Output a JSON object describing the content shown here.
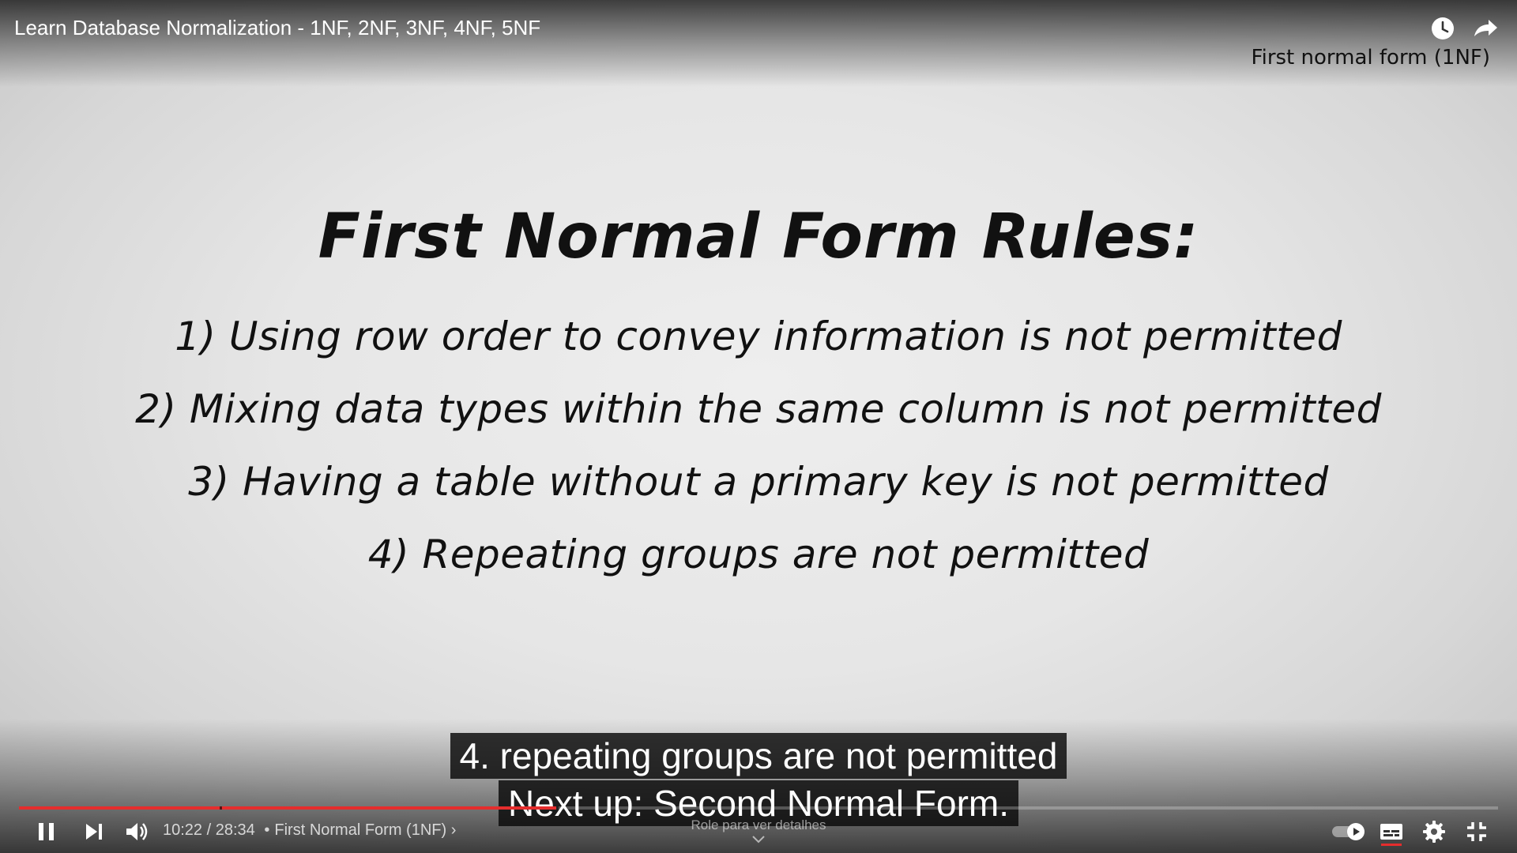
{
  "header": {
    "video_title": "Learn Database Normalization - 1NF, 2NF, 3NF, 4NF, 5NF",
    "chapter_label": "First normal form (1NF)",
    "icons": [
      "watch-later-icon",
      "share-icon"
    ]
  },
  "slide": {
    "heading": "First Normal Form Rules:",
    "rules": [
      "1) Using row order to convey information is not permitted",
      "2) Mixing data types within the same column is not permitted",
      "3) Having a table without a primary key is not permitted",
      "4) Repeating groups are not permitted"
    ]
  },
  "captions": {
    "line1": "4. repeating groups are not permitted",
    "line2": "Next up: Second Normal Form."
  },
  "controls": {
    "time_current": "10:22",
    "time_total": "28:34",
    "time_separator": "/",
    "chapter_separator": "•",
    "chapter": "First Normal Form (1NF)",
    "chapter_chevron": "›",
    "scroll_hint": "Role para ver detalhes",
    "progress_fraction": 0.363,
    "buttons": [
      "pause-icon",
      "next-icon",
      "volume-icon",
      "autoplay-toggle",
      "subtitles-icon",
      "settings-icon",
      "exit-fullscreen-icon"
    ]
  },
  "colors": {
    "progress": "#e52d2d",
    "caption_bg": "#080808",
    "caption_text": "#ffffff"
  }
}
